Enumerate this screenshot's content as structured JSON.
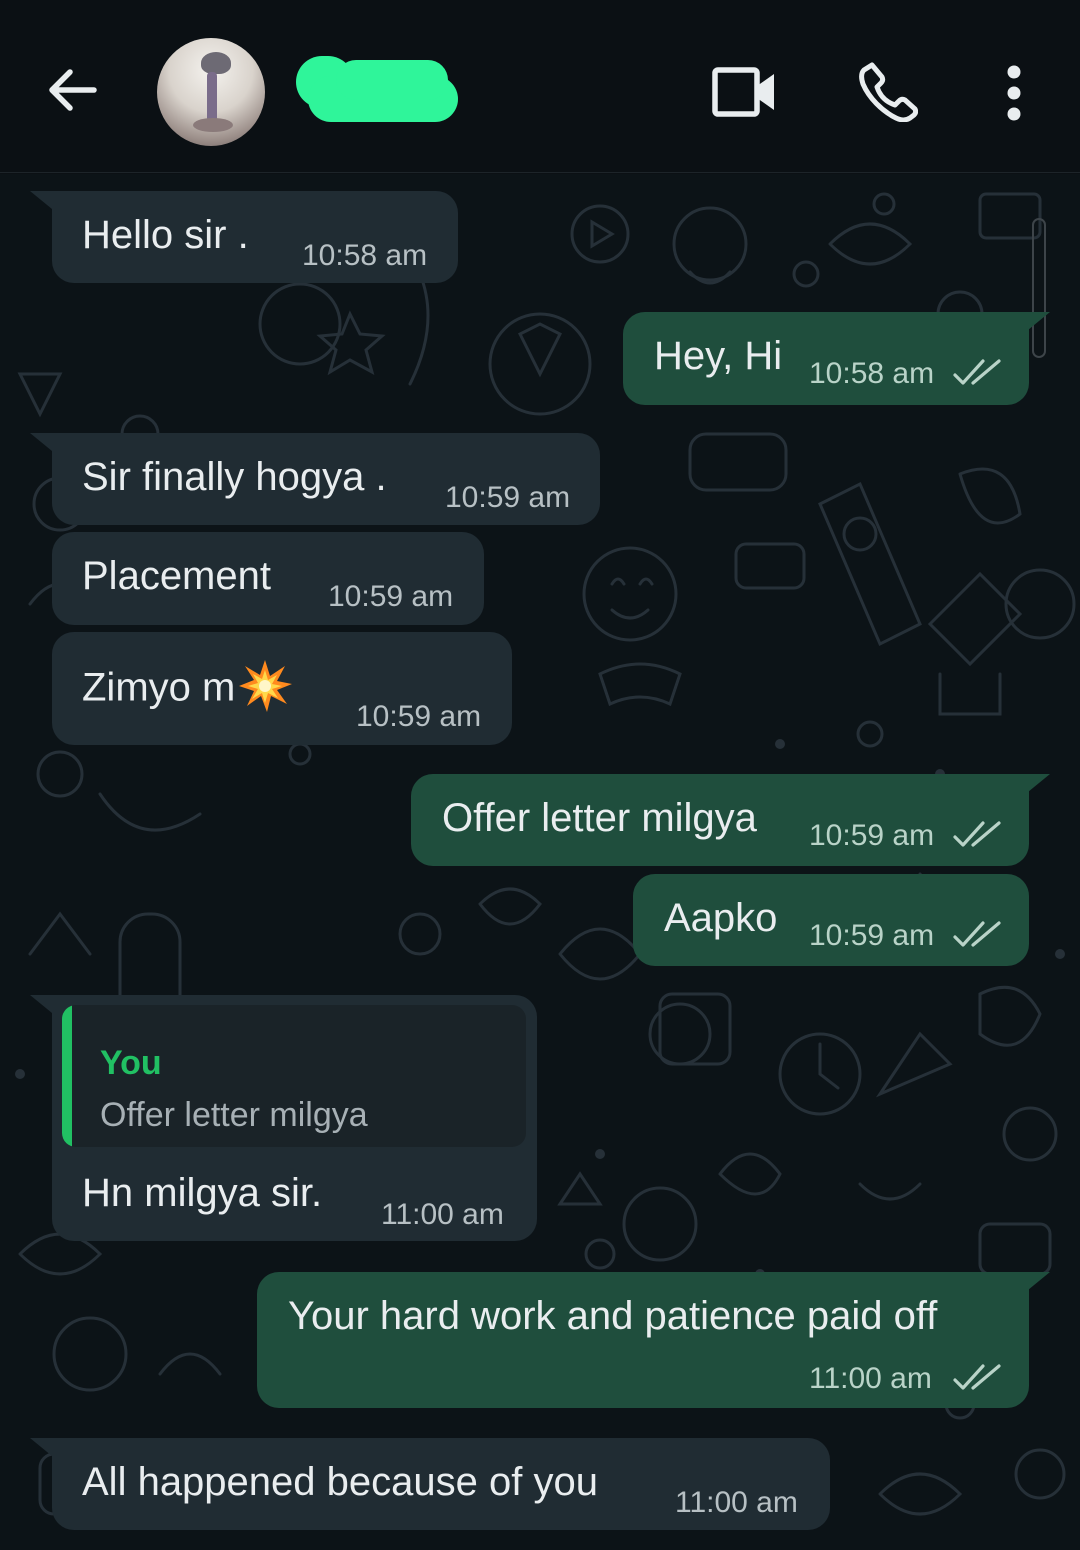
{
  "header": {
    "contact_name": "",
    "icons": [
      "arrow-left-icon",
      "video-camera-icon",
      "phone-icon",
      "more-vert-icon"
    ]
  },
  "colors": {
    "incoming_bubble": "#202c33",
    "outgoing_bubble": "#1f4e3d",
    "accent_green": "#21c063",
    "background": "#0b1014"
  },
  "messages": [
    {
      "direction": "in",
      "text": "Hello sir .",
      "time": "10:58 am"
    },
    {
      "direction": "out",
      "text": "Hey, Hi",
      "time": "10:58 am",
      "status": "read"
    },
    {
      "direction": "in",
      "text": "Sir finally hogya .",
      "time": "10:59 am"
    },
    {
      "direction": "in",
      "text": "Placement",
      "time": "10:59 am"
    },
    {
      "direction": "in",
      "text": "Zimyo m",
      "emoji": "collision-emoji",
      "time": "10:59 am"
    },
    {
      "direction": "out",
      "text": "Offer letter milgya",
      "time": "10:59 am",
      "status": "read"
    },
    {
      "direction": "out",
      "text": "Aapko",
      "time": "10:59 am",
      "status": "read"
    },
    {
      "direction": "in",
      "text": "Hn milgya sir.",
      "time": "11:00 am",
      "reply_to": {
        "author": "You",
        "text": "Offer letter milgya"
      }
    },
    {
      "direction": "out",
      "text": "Your hard work and patience paid off",
      "time": "11:00 am",
      "status": "read"
    },
    {
      "direction": "in",
      "text": "All happened because of you",
      "time": "11:00 am"
    }
  ]
}
